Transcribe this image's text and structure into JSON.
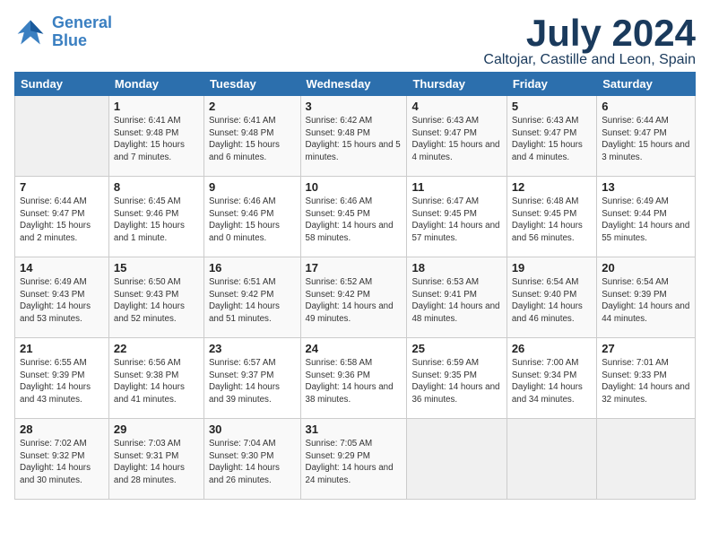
{
  "header": {
    "logo_line1": "General",
    "logo_line2": "Blue",
    "month": "July 2024",
    "location": "Caltojar, Castille and Leon, Spain"
  },
  "weekdays": [
    "Sunday",
    "Monday",
    "Tuesday",
    "Wednesday",
    "Thursday",
    "Friday",
    "Saturday"
  ],
  "weeks": [
    [
      {
        "day": "",
        "sunrise": "",
        "sunset": "",
        "daylight": ""
      },
      {
        "day": "1",
        "sunrise": "Sunrise: 6:41 AM",
        "sunset": "Sunset: 9:48 PM",
        "daylight": "Daylight: 15 hours and 7 minutes."
      },
      {
        "day": "2",
        "sunrise": "Sunrise: 6:41 AM",
        "sunset": "Sunset: 9:48 PM",
        "daylight": "Daylight: 15 hours and 6 minutes."
      },
      {
        "day": "3",
        "sunrise": "Sunrise: 6:42 AM",
        "sunset": "Sunset: 9:48 PM",
        "daylight": "Daylight: 15 hours and 5 minutes."
      },
      {
        "day": "4",
        "sunrise": "Sunrise: 6:43 AM",
        "sunset": "Sunset: 9:47 PM",
        "daylight": "Daylight: 15 hours and 4 minutes."
      },
      {
        "day": "5",
        "sunrise": "Sunrise: 6:43 AM",
        "sunset": "Sunset: 9:47 PM",
        "daylight": "Daylight: 15 hours and 4 minutes."
      },
      {
        "day": "6",
        "sunrise": "Sunrise: 6:44 AM",
        "sunset": "Sunset: 9:47 PM",
        "daylight": "Daylight: 15 hours and 3 minutes."
      }
    ],
    [
      {
        "day": "7",
        "sunrise": "Sunrise: 6:44 AM",
        "sunset": "Sunset: 9:47 PM",
        "daylight": "Daylight: 15 hours and 2 minutes."
      },
      {
        "day": "8",
        "sunrise": "Sunrise: 6:45 AM",
        "sunset": "Sunset: 9:46 PM",
        "daylight": "Daylight: 15 hours and 1 minute."
      },
      {
        "day": "9",
        "sunrise": "Sunrise: 6:46 AM",
        "sunset": "Sunset: 9:46 PM",
        "daylight": "Daylight: 15 hours and 0 minutes."
      },
      {
        "day": "10",
        "sunrise": "Sunrise: 6:46 AM",
        "sunset": "Sunset: 9:45 PM",
        "daylight": "Daylight: 14 hours and 58 minutes."
      },
      {
        "day": "11",
        "sunrise": "Sunrise: 6:47 AM",
        "sunset": "Sunset: 9:45 PM",
        "daylight": "Daylight: 14 hours and 57 minutes."
      },
      {
        "day": "12",
        "sunrise": "Sunrise: 6:48 AM",
        "sunset": "Sunset: 9:45 PM",
        "daylight": "Daylight: 14 hours and 56 minutes."
      },
      {
        "day": "13",
        "sunrise": "Sunrise: 6:49 AM",
        "sunset": "Sunset: 9:44 PM",
        "daylight": "Daylight: 14 hours and 55 minutes."
      }
    ],
    [
      {
        "day": "14",
        "sunrise": "Sunrise: 6:49 AM",
        "sunset": "Sunset: 9:43 PM",
        "daylight": "Daylight: 14 hours and 53 minutes."
      },
      {
        "day": "15",
        "sunrise": "Sunrise: 6:50 AM",
        "sunset": "Sunset: 9:43 PM",
        "daylight": "Daylight: 14 hours and 52 minutes."
      },
      {
        "day": "16",
        "sunrise": "Sunrise: 6:51 AM",
        "sunset": "Sunset: 9:42 PM",
        "daylight": "Daylight: 14 hours and 51 minutes."
      },
      {
        "day": "17",
        "sunrise": "Sunrise: 6:52 AM",
        "sunset": "Sunset: 9:42 PM",
        "daylight": "Daylight: 14 hours and 49 minutes."
      },
      {
        "day": "18",
        "sunrise": "Sunrise: 6:53 AM",
        "sunset": "Sunset: 9:41 PM",
        "daylight": "Daylight: 14 hours and 48 minutes."
      },
      {
        "day": "19",
        "sunrise": "Sunrise: 6:54 AM",
        "sunset": "Sunset: 9:40 PM",
        "daylight": "Daylight: 14 hours and 46 minutes."
      },
      {
        "day": "20",
        "sunrise": "Sunrise: 6:54 AM",
        "sunset": "Sunset: 9:39 PM",
        "daylight": "Daylight: 14 hours and 44 minutes."
      }
    ],
    [
      {
        "day": "21",
        "sunrise": "Sunrise: 6:55 AM",
        "sunset": "Sunset: 9:39 PM",
        "daylight": "Daylight: 14 hours and 43 minutes."
      },
      {
        "day": "22",
        "sunrise": "Sunrise: 6:56 AM",
        "sunset": "Sunset: 9:38 PM",
        "daylight": "Daylight: 14 hours and 41 minutes."
      },
      {
        "day": "23",
        "sunrise": "Sunrise: 6:57 AM",
        "sunset": "Sunset: 9:37 PM",
        "daylight": "Daylight: 14 hours and 39 minutes."
      },
      {
        "day": "24",
        "sunrise": "Sunrise: 6:58 AM",
        "sunset": "Sunset: 9:36 PM",
        "daylight": "Daylight: 14 hours and 38 minutes."
      },
      {
        "day": "25",
        "sunrise": "Sunrise: 6:59 AM",
        "sunset": "Sunset: 9:35 PM",
        "daylight": "Daylight: 14 hours and 36 minutes."
      },
      {
        "day": "26",
        "sunrise": "Sunrise: 7:00 AM",
        "sunset": "Sunset: 9:34 PM",
        "daylight": "Daylight: 14 hours and 34 minutes."
      },
      {
        "day": "27",
        "sunrise": "Sunrise: 7:01 AM",
        "sunset": "Sunset: 9:33 PM",
        "daylight": "Daylight: 14 hours and 32 minutes."
      }
    ],
    [
      {
        "day": "28",
        "sunrise": "Sunrise: 7:02 AM",
        "sunset": "Sunset: 9:32 PM",
        "daylight": "Daylight: 14 hours and 30 minutes."
      },
      {
        "day": "29",
        "sunrise": "Sunrise: 7:03 AM",
        "sunset": "Sunset: 9:31 PM",
        "daylight": "Daylight: 14 hours and 28 minutes."
      },
      {
        "day": "30",
        "sunrise": "Sunrise: 7:04 AM",
        "sunset": "Sunset: 9:30 PM",
        "daylight": "Daylight: 14 hours and 26 minutes."
      },
      {
        "day": "31",
        "sunrise": "Sunrise: 7:05 AM",
        "sunset": "Sunset: 9:29 PM",
        "daylight": "Daylight: 14 hours and 24 minutes."
      },
      {
        "day": "",
        "sunrise": "",
        "sunset": "",
        "daylight": ""
      },
      {
        "day": "",
        "sunrise": "",
        "sunset": "",
        "daylight": ""
      },
      {
        "day": "",
        "sunrise": "",
        "sunset": "",
        "daylight": ""
      }
    ]
  ]
}
